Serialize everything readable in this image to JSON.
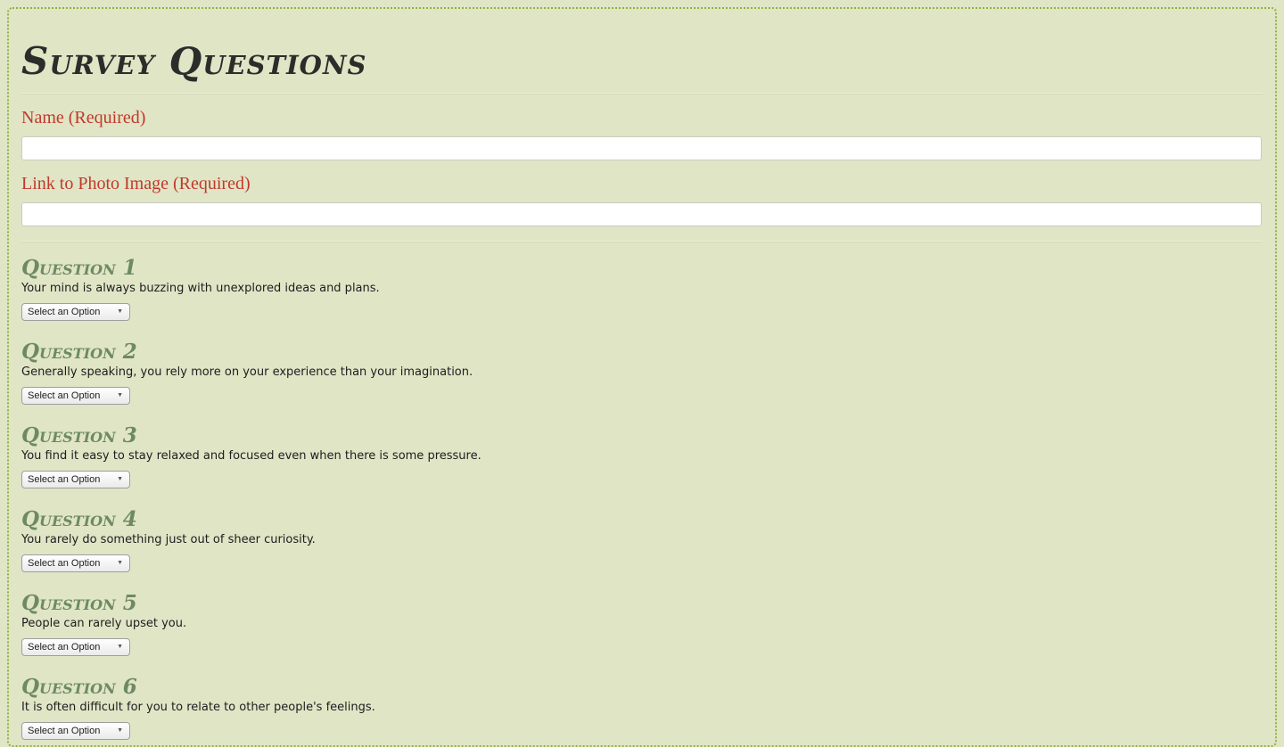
{
  "page": {
    "title": "Survey Questions"
  },
  "fields": {
    "name_label": "Name (Required)",
    "name_value": "",
    "photo_label": "Link to Photo Image (Required)",
    "photo_value": ""
  },
  "questions": [
    {
      "heading": "Question 1",
      "text": "Your mind is always buzzing with unexplored ideas and plans.",
      "selected": "Select an Option"
    },
    {
      "heading": "Question 2",
      "text": "Generally speaking, you rely more on your experience than your imagination.",
      "selected": "Select an Option"
    },
    {
      "heading": "Question 3",
      "text": "You find it easy to stay relaxed and focused even when there is some pressure.",
      "selected": "Select an Option"
    },
    {
      "heading": "Question 4",
      "text": "You rarely do something just out of sheer curiosity.",
      "selected": "Select an Option"
    },
    {
      "heading": "Question 5",
      "text": "People can rarely upset you.",
      "selected": "Select an Option"
    },
    {
      "heading": "Question 6",
      "text": "It is often difficult for you to relate to other people's feelings.",
      "selected": "Select an Option"
    }
  ],
  "icons": {
    "dropdown": "chevron-down-icon"
  },
  "colors": {
    "background": "#e0e5c6",
    "border": "#8fb33f",
    "required_label": "#c0392b",
    "question_heading": "#6d8a63"
  }
}
